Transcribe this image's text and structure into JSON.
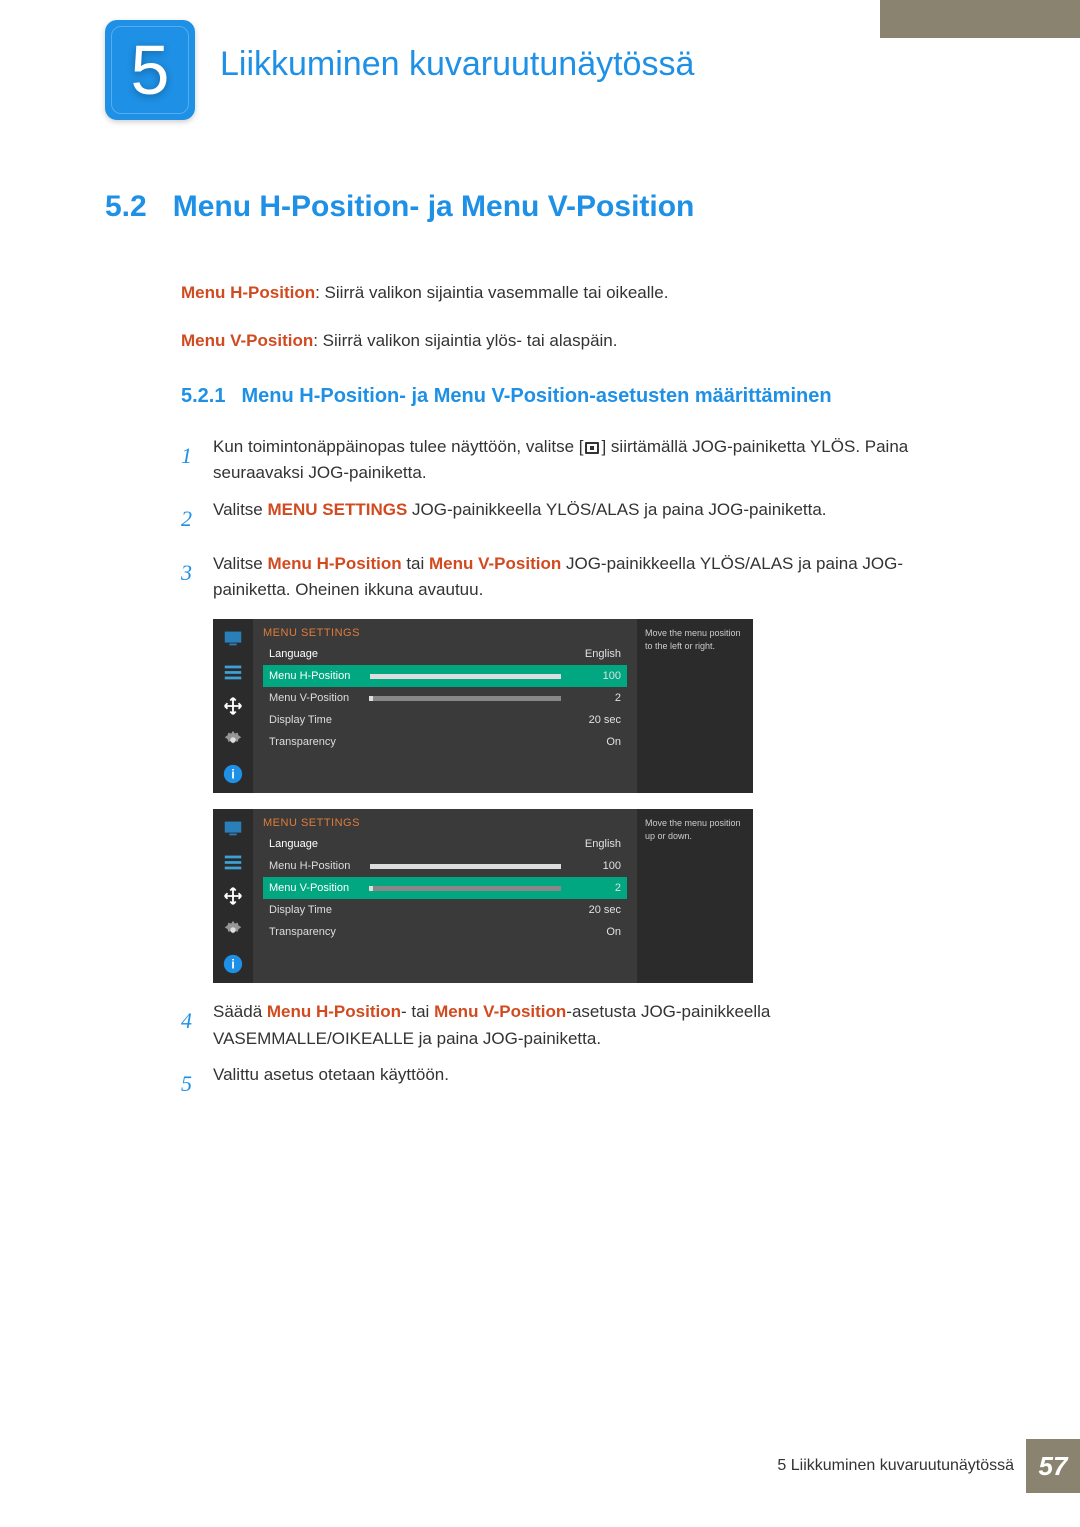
{
  "chapter": {
    "num": "5",
    "title": "Liikkuminen kuvaruutunäytössä"
  },
  "section": {
    "num": "5.2",
    "title": "Menu H-Position- ja Menu V-Position"
  },
  "defs": {
    "h_label": "Menu H-Position",
    "h_text": ": Siirrä valikon sijaintia vasemmalle tai oikealle.",
    "v_label": "Menu V-Position",
    "v_text": ": Siirrä valikon sijaintia ylös- tai alaspäin."
  },
  "subsection": {
    "num": "5.2.1",
    "title": "Menu H-Position- ja Menu V-Position-asetusten määrittäminen"
  },
  "steps": {
    "s1a": "Kun toimintonäppäinopas tulee näyttöön, valitse [",
    "s1b": "] siirtämällä JOG-painiketta YLÖS. Paina seuraavaksi JOG-painiketta.",
    "s2a": "Valitse ",
    "s2b": "MENU SETTINGS",
    "s2c": " JOG-painikkeella YLÖS/ALAS ja paina JOG-painiketta.",
    "s3a": "Valitse ",
    "s3b": "Menu H-Position",
    "s3c": " tai ",
    "s3d": "Menu V-Position",
    "s3e": " JOG-painikkeella YLÖS/ALAS ja paina JOG-painiketta. Oheinen ikkuna avautuu.",
    "s4a": "Säädä ",
    "s4b": "Menu H-Position",
    "s4c": "- tai ",
    "s4d": "Menu V-Position",
    "s4e": "-asetusta JOG-painikkeella VASEMMALLE/OIKEALLE ja paina JOG-painiketta.",
    "s5": "Valittu asetus otetaan käyttöön."
  },
  "nums": {
    "n1": "1",
    "n2": "2",
    "n3": "3",
    "n4": "4",
    "n5": "5"
  },
  "osd1": {
    "title": "MENU SETTINGS",
    "rows": {
      "lang_l": "Language",
      "lang_v": "English",
      "hpos_l": "Menu H-Position",
      "hpos_v": "100",
      "vpos_l": "Menu V-Position",
      "vpos_v": "2",
      "disp_l": "Display Time",
      "disp_v": "20 sec",
      "tr_l": "Transparency",
      "tr_v": "On"
    },
    "tip": "Move the menu position to the left or right."
  },
  "osd2": {
    "title": "MENU SETTINGS",
    "rows": {
      "lang_l": "Language",
      "lang_v": "English",
      "hpos_l": "Menu H-Position",
      "hpos_v": "100",
      "vpos_l": "Menu V-Position",
      "vpos_v": "2",
      "disp_l": "Display Time",
      "disp_v": "20 sec",
      "tr_l": "Transparency",
      "tr_v": "On"
    },
    "tip": "Move the menu position up or down."
  },
  "footer": {
    "text": "5 Liikkuminen kuvaruutunäytössä",
    "page": "57"
  }
}
